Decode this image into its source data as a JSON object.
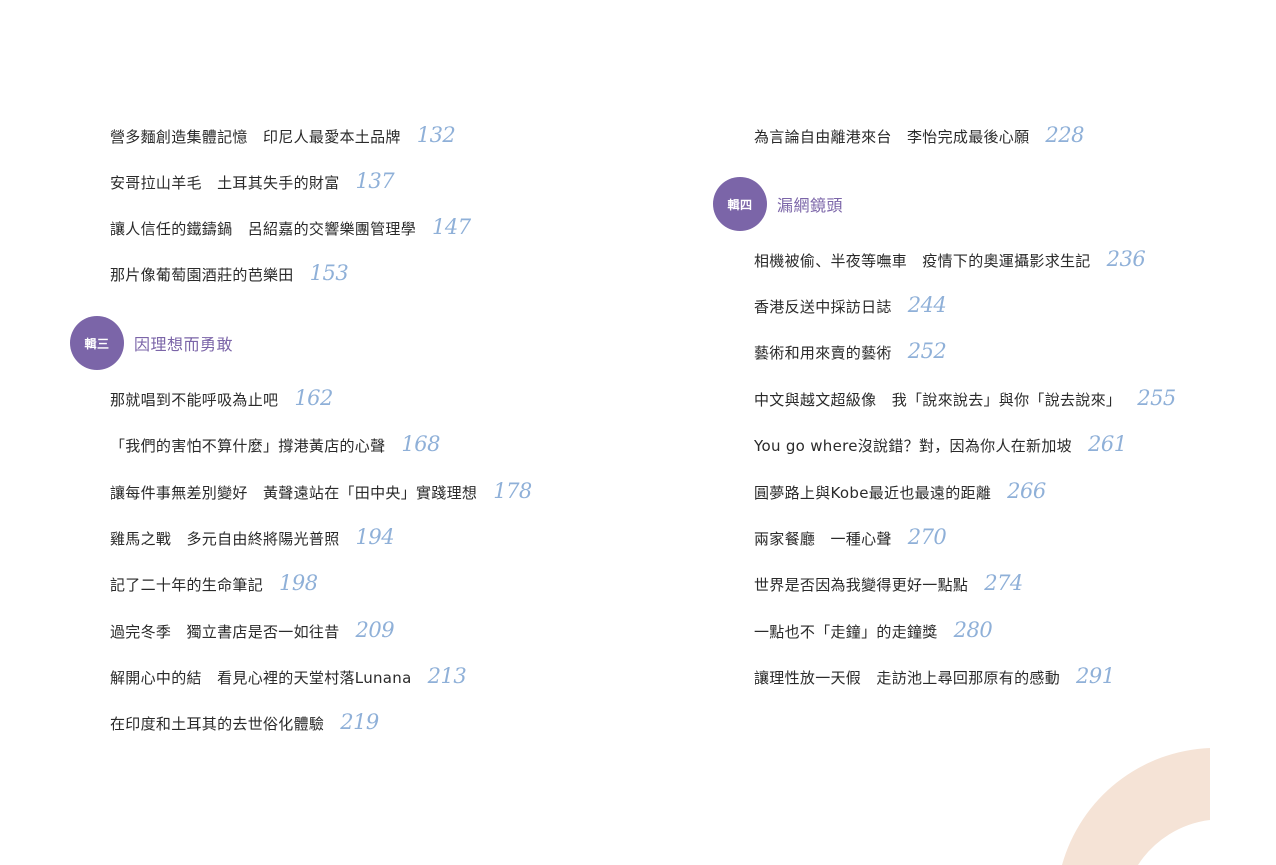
{
  "left": {
    "entries_top": [
      {
        "title": "營多麵創造集體記憶　印尼人最愛本土品牌",
        "page": "132"
      },
      {
        "title": "安哥拉山羊毛　土耳其失手的財富",
        "page": "137"
      },
      {
        "title": "讓人信任的鐵鑄鍋　呂紹嘉的交響樂團管理學",
        "page": "147"
      },
      {
        "title": "那片像葡萄園酒莊的芭樂田",
        "page": "153"
      }
    ],
    "section": {
      "badge": "輯三",
      "title": "因理想而勇敢"
    },
    "entries_bottom": [
      {
        "title": "那就唱到不能呼吸為止吧",
        "page": "162"
      },
      {
        "title": "「我們的害怕不算什麼」撐港黃店的心聲",
        "page": "168"
      },
      {
        "title": "讓每件事無差別變好　黃聲遠站在「田中央」實踐理想",
        "page": "178"
      },
      {
        "title": "雞馬之戰　多元自由終將陽光普照",
        "page": "194"
      },
      {
        "title": "記了二十年的生命筆記",
        "page": "198"
      },
      {
        "title": "過完冬季　獨立書店是否一如往昔",
        "page": "209"
      },
      {
        "title": "解開心中的結　看見心裡的天堂村落Lunana",
        "page": "213"
      },
      {
        "title": "在印度和土耳其的去世俗化體驗",
        "page": "219"
      }
    ]
  },
  "right": {
    "entries_top": [
      {
        "title": "為言論自由離港來台　李怡完成最後心願",
        "page": "228"
      }
    ],
    "section": {
      "badge": "輯四",
      "title": "漏網鏡頭"
    },
    "entries_bottom": [
      {
        "title": "相機被偷、半夜等嘸車　疫情下的奧運攝影求生記",
        "page": "236"
      },
      {
        "title": "香港反送中採訪日誌",
        "page": "244"
      },
      {
        "title": "藝術和用來賣的藝術",
        "page": "252"
      },
      {
        "title": "中文與越文超級像　我「說來說去」與你「說去說來」",
        "page": "255"
      },
      {
        "title": "You go where沒說錯？對，因為你人在新加坡",
        "page": "261"
      },
      {
        "title": "圓夢路上與Kobe最近也最遠的距離",
        "page": "266"
      },
      {
        "title": "兩家餐廳　一種心聲",
        "page": "270"
      },
      {
        "title": "世界是否因為我變得更好一點點",
        "page": "274"
      },
      {
        "title": "一點也不「走鐘」的走鐘獎",
        "page": "280"
      },
      {
        "title": "讓理性放一天假　走訪池上尋回那原有的感動",
        "page": "291"
      }
    ]
  },
  "colors": {
    "accent": "#7b65a8",
    "page_number": "#8fb0d8",
    "decoration": "#f5e3d6"
  }
}
